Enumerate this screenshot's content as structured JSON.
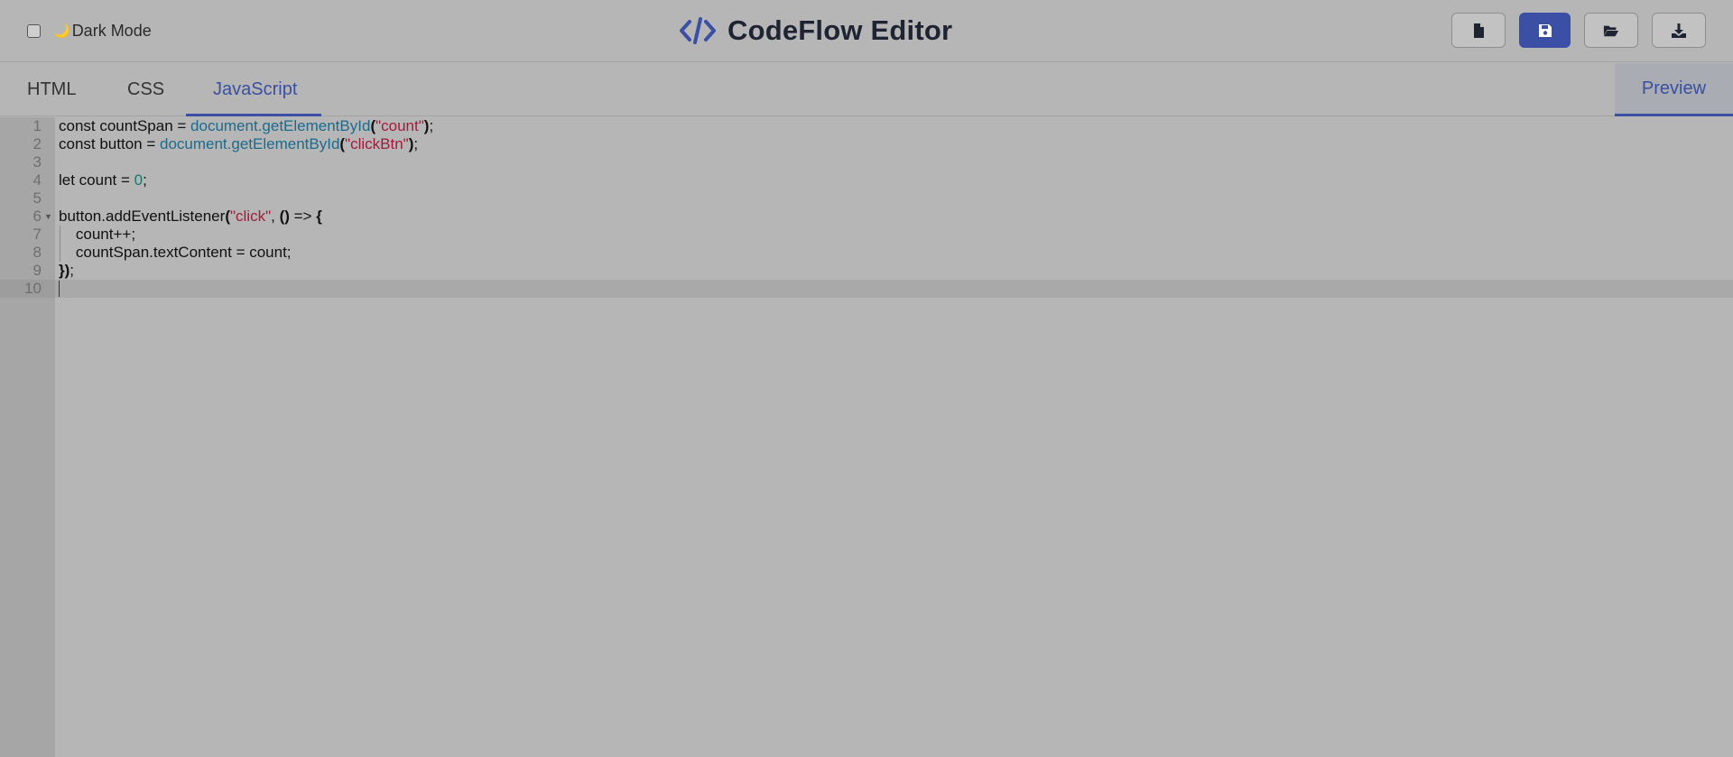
{
  "header": {
    "dark_mode_label": "Dark Mode",
    "app_title": "CodeFlow Editor",
    "accent_color": "#3b50a5",
    "tools": [
      {
        "name": "new-file-button",
        "icon": "file-icon"
      },
      {
        "name": "save-button",
        "icon": "floppy-disk-icon"
      },
      {
        "name": "open-folder-button",
        "icon": "folder-open-icon"
      },
      {
        "name": "download-button",
        "icon": "download-icon"
      }
    ]
  },
  "tabs": {
    "items": [
      "HTML",
      "CSS",
      "JavaScript"
    ],
    "active": "JavaScript",
    "preview": "Preview"
  },
  "editor": {
    "language": "JavaScript",
    "line_numbers": [
      "1",
      "2",
      "3",
      "4",
      "5",
      "6",
      "7",
      "8",
      "9",
      "10"
    ],
    "lines": [
      "const countSpan = document.getElementById(\"count\");",
      "const button = document.getElementById(\"clickBtn\");",
      "",
      "let count = 0;",
      "",
      "button.addEventListener(\"click\", () => {",
      "    count++;",
      "    countSpan.textContent = count;",
      "});",
      ""
    ],
    "active_line": 10
  }
}
